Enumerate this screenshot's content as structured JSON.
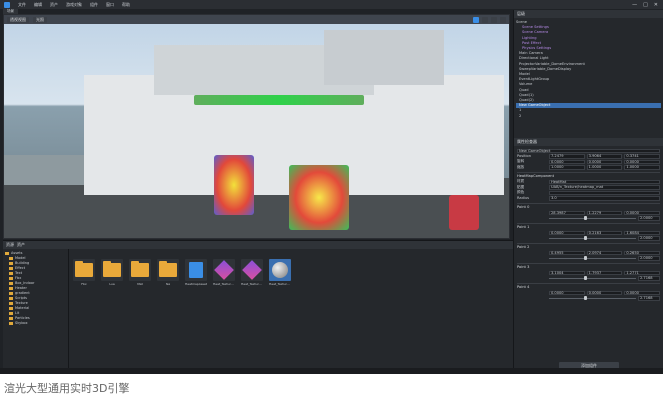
{
  "menubar": {
    "items": [
      "文件",
      "编辑",
      "资产",
      "游戏对象",
      "组件",
      "窗口",
      "帮助"
    ]
  },
  "viewport": {
    "tab": "场景",
    "toolbar_buttons": [
      "透视视图",
      "光照"
    ],
    "mode_buttons": 4
  },
  "hierarchy": {
    "title": "层级",
    "items": [
      {
        "label": "Scene",
        "style": ""
      },
      {
        "label": "Scene Settings",
        "style": "purple"
      },
      {
        "label": "Scene Camera",
        "style": "purple"
      },
      {
        "label": "Lighting",
        "style": "purple"
      },
      {
        "label": "Post Effect",
        "style": "purple"
      },
      {
        "label": "Physics Settings",
        "style": "purple"
      },
      {
        "label": "Main Camera",
        "style": ""
      },
      {
        "label": "Directional Light",
        "style": ""
      },
      {
        "label": "ProjectorVariable_DomeEnvironment",
        "style": ""
      },
      {
        "label": "SweepVariable_DomeDisplay",
        "style": ""
      },
      {
        "label": "Model",
        "style": ""
      },
      {
        "label": "EventLightGroup",
        "style": ""
      },
      {
        "label": "Volume",
        "style": ""
      },
      {
        "label": "Quad",
        "style": ""
      },
      {
        "label": "Quad(1)",
        "style": ""
      },
      {
        "label": "Quad(2)",
        "style": ""
      },
      {
        "label": "New GameObject",
        "style": "sel"
      },
      {
        "label": "1",
        "style": ""
      },
      {
        "label": "2",
        "style": ""
      }
    ]
  },
  "inspector": {
    "title": "属性检查器",
    "name_field": "New GameObject",
    "transform_rows": [
      {
        "label": "Position",
        "values": [
          "7.2479",
          "3.9064",
          "0.3741"
        ]
      },
      {
        "label": "旋转",
        "values": [
          "0.0000",
          "0.0000",
          "0.0000"
        ]
      },
      {
        "label": "缩放",
        "values": [
          "1.0000",
          "1.0000",
          "1.0000"
        ]
      }
    ],
    "component_title": "HeatMapComponent",
    "component_rows": [
      {
        "label": "材质",
        "value": "HeatMat"
      },
      {
        "label": "贴图",
        "value": "UAB/n_Texture/heatmap_mat"
      },
      {
        "label": "颜色",
        "value": ""
      },
      {
        "label": "Radius",
        "value": "3.0"
      }
    ],
    "points": [
      {
        "name": "Point 0",
        "position": [
          "28.3987",
          "1.2279",
          "0.0000"
        ],
        "temperature": "2.0000"
      },
      {
        "name": "Point 1",
        "position": [
          "0.0000",
          "0.2163",
          "1.6084"
        ],
        "temperature": "2.0000"
      },
      {
        "name": "Point 2",
        "position": [
          "0.4955",
          "2.0974",
          "0.2650"
        ],
        "temperature": "2.0000"
      },
      {
        "name": "Point 3",
        "position": [
          "3.1004",
          "1.7937",
          "1.2771"
        ],
        "temperature": "2.7168"
      },
      {
        "name": "Point 4",
        "position": [
          "0.0000",
          "0.0000",
          "0.0000"
        ],
        "temperature": "2.7168"
      }
    ],
    "add_button": "添加组件"
  },
  "project": {
    "tabs": [
      "资源",
      "资产"
    ],
    "tree": [
      "Assets",
      "Model",
      "Building",
      "Effect",
      "Text",
      "Fbx",
      "Box_Indoor",
      "Heater",
      "gradient",
      "Scripts",
      "Texture",
      "Material",
      "Lit",
      "Particles",
      "Skybox"
    ],
    "assets": [
      {
        "label": "Fbx",
        "kind": "folder"
      },
      {
        "label": "Lua",
        "kind": "folder"
      },
      {
        "label": "Mat",
        "kind": "folder"
      },
      {
        "label": "Tex",
        "kind": "folder"
      },
      {
        "label": "HeatmapAsset",
        "kind": "script"
      },
      {
        "label": "Heat_Texture.dynamicCon",
        "kind": "effect"
      },
      {
        "label": "Heat_Texture.dynamicCon2",
        "kind": "effect"
      },
      {
        "label": "Heat_Texture.dynamicCon3",
        "kind": "sphere"
      }
    ]
  },
  "caption": "渲光大型通用实时3D引擎",
  "colors": {
    "accent": "#3a8ee6",
    "folder": "#e9a93a",
    "panel": "#25282c"
  }
}
